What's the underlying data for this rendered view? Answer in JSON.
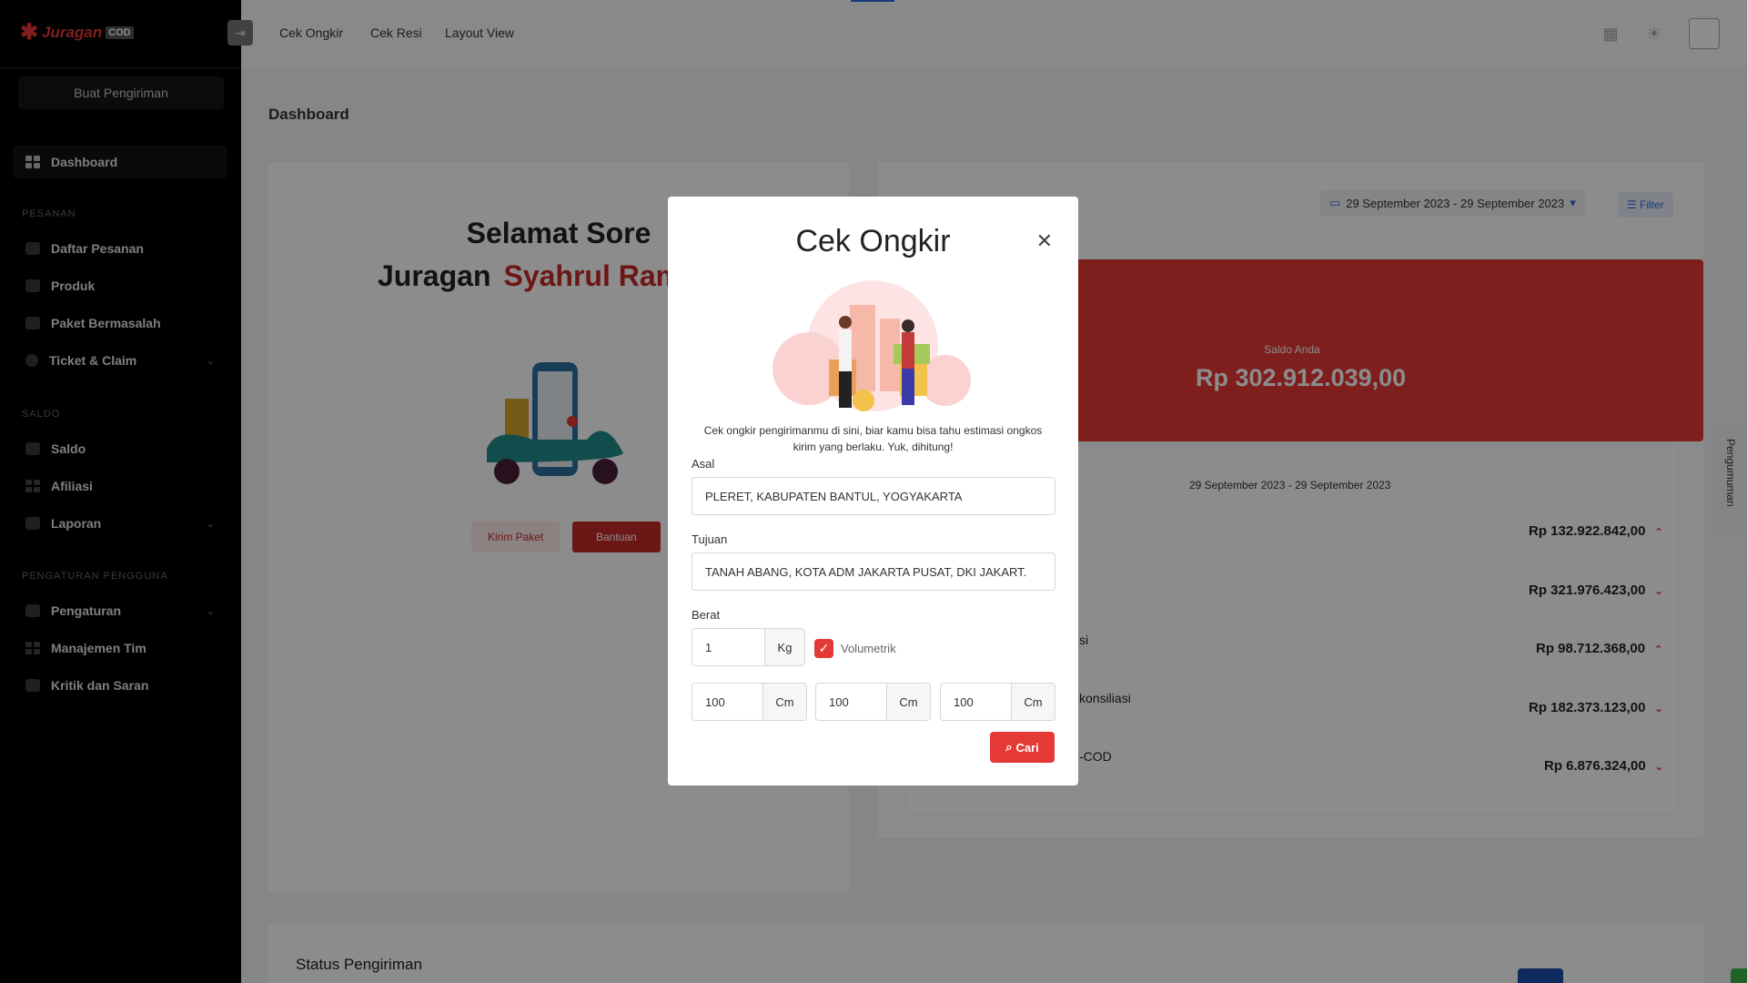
{
  "sidebar": {
    "logo_brand": "Juragan",
    "logo_badge": "COD",
    "create_button": "Buat Pengiriman",
    "dashboard": "Dashboard",
    "sections": {
      "pesanan": "PESANAN",
      "saldo": "SALDO",
      "pengaturan": "PENGATURAN PENGGUNA"
    },
    "items": {
      "daftar_pesanan": "Daftar Pesanan",
      "produk": "Produk",
      "paket_bermasalah": "Paket Bermasalah",
      "ticket_claim": "Ticket & Claim",
      "saldo": "Saldo",
      "afiliasi": "Afiliasi",
      "laporan": "Laporan",
      "pengaturan": "Pengaturan",
      "manajemen_tim": "Manajemen Tim",
      "kritik_saran": "Kritik dan Saran"
    }
  },
  "topbar": {
    "links": [
      "Cek Ongkir",
      "Cek Resi",
      "Layout View"
    ]
  },
  "page": {
    "title": "Dashboard",
    "greeting_line1": "Selamat Sore",
    "greeting_prefix": "Juragan",
    "greeting_name": "Syahrul Rama",
    "kirim_paket": "Kirim Paket",
    "bantuan": "Bantuan",
    "date_range": "29 September 2023 - 29 September 2023",
    "filter": "Filter",
    "saldo_label": "Saldo Anda",
    "saldo_value": "Rp 302.912.039,00",
    "stats_date": "29 September 2023 - 29 September 2023",
    "stats": [
      {
        "label": "",
        "value": "Rp 132.922.842,00",
        "trend": "up"
      },
      {
        "label": "",
        "value": "Rp 321.976.423,00",
        "trend": "down"
      },
      {
        "label": "si",
        "value": "Rp 98.712.368,00",
        "trend": "up"
      },
      {
        "label": "konsiliasi",
        "value": "Rp 182.373.123,00",
        "trend": "down"
      },
      {
        "label": "-COD",
        "value": "Rp 6.876.324,00",
        "trend": "down"
      }
    ],
    "status_title": "Status Pengiriman",
    "side_tab": "Pengumuman"
  },
  "modal": {
    "title": "Cek Ongkir",
    "description": "Cek ongkir pengirimanmu di sini, biar kamu bisa tahu estimasi ongkos kirim yang berlaku. Yuk, dihitung!",
    "asal_label": "Asal",
    "asal_value": "PLERET, KABUPATEN BANTUL, YOGYAKARTA",
    "tujuan_label": "Tujuan",
    "tujuan_value": "TANAH ABANG, KOTA ADM JAKARTA PUSAT, DKI JAKART.",
    "berat_label": "Berat",
    "berat_value": "1",
    "berat_unit": "Kg",
    "volumetrik_label": "Volumetrik",
    "volumetrik_checked": true,
    "dimensions": [
      {
        "value": "100",
        "unit": "Cm"
      },
      {
        "value": "100",
        "unit": "Cm"
      },
      {
        "value": "100",
        "unit": "Cm"
      }
    ],
    "search_button": "Cari"
  },
  "colors": {
    "accent": "#e53935",
    "sidebar_bg": "#000000",
    "overlay": "rgba(0,0,0,0.45)"
  }
}
